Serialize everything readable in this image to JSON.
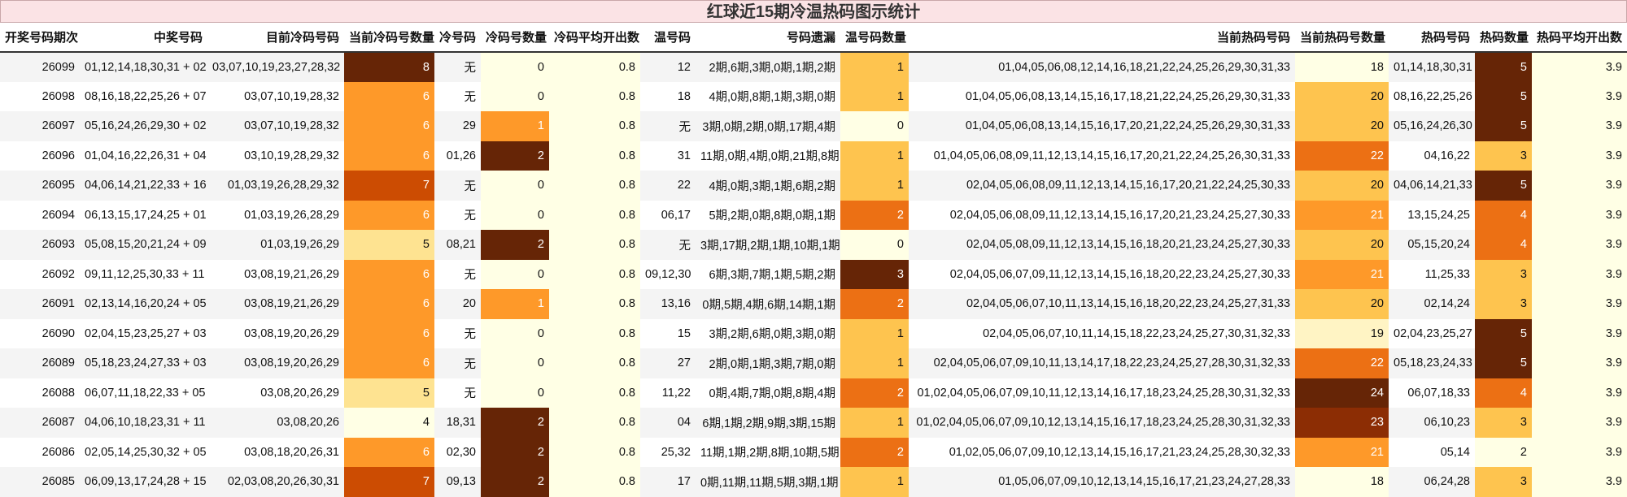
{
  "title": "红球近15期冷温热码图示统计",
  "headers": [
    "开奖号码期次",
    "中奖号码",
    "目前冷码号码",
    "当前冷码号数量",
    "冷号码",
    "冷码号数量",
    "冷码平均开出数",
    "温号码",
    "号码遗漏",
    "温号码数量",
    "当前热码号码",
    "当前热码号数量",
    "热码号码",
    "热码数量",
    "热码平均开出数"
  ],
  "colors": {
    "lv0": "#ffffe5",
    "lv1": "#fff4c4",
    "lv2": "#fee391",
    "lv3": "#fec44f",
    "lv4": "#fe9929",
    "lv5": "#ec7014",
    "lv6": "#cc4c02",
    "lv7": "#8c2d04",
    "lv8": "#662506"
  },
  "rows": [
    [
      "26099",
      "01,12,14,18,30,31 + 02",
      "03,07,10,19,23,27,28,32",
      "8",
      "无",
      "0",
      "0.8",
      "12",
      "2期,6期,3期,0期,1期,2期",
      "1",
      "01,04,05,06,08,12,14,16,18,21,22,24,25,26,29,30,31,33",
      "18",
      "01,14,18,30,31",
      "5",
      "3.9"
    ],
    [
      "26098",
      "08,16,18,22,25,26 + 07",
      "03,07,10,19,28,32",
      "6",
      "无",
      "0",
      "0.8",
      "18",
      "4期,0期,8期,1期,3期,0期",
      "1",
      "01,04,05,06,08,13,14,15,16,17,18,21,22,24,25,26,29,30,31,33",
      "20",
      "08,16,22,25,26",
      "5",
      "3.9"
    ],
    [
      "26097",
      "05,16,24,26,29,30 + 02",
      "03,07,10,19,28,32",
      "6",
      "29",
      "1",
      "0.8",
      "无",
      "3期,0期,2期,0期,17期,4期",
      "0",
      "01,04,05,06,08,13,14,15,16,17,20,21,22,24,25,26,29,30,31,33",
      "20",
      "05,16,24,26,30",
      "5",
      "3.9"
    ],
    [
      "26096",
      "01,04,16,22,26,31 + 04",
      "03,10,19,28,29,32",
      "6",
      "01,26",
      "2",
      "0.8",
      "31",
      "11期,0期,4期,0期,21期,8期",
      "1",
      "01,04,05,06,08,09,11,12,13,14,15,16,17,20,21,22,24,25,26,30,31,33",
      "22",
      "04,16,22",
      "3",
      "3.9"
    ],
    [
      "26095",
      "04,06,14,21,22,33 + 16",
      "01,03,19,26,28,29,32",
      "7",
      "无",
      "0",
      "0.8",
      "22",
      "4期,0期,3期,1期,6期,2期",
      "1",
      "02,04,05,06,08,09,11,12,13,14,15,16,17,20,21,22,24,25,30,33",
      "20",
      "04,06,14,21,33",
      "5",
      "3.9"
    ],
    [
      "26094",
      "06,13,15,17,24,25 + 01",
      "01,03,19,26,28,29",
      "6",
      "无",
      "0",
      "0.8",
      "06,17",
      "5期,2期,0期,8期,0期,1期",
      "2",
      "02,04,05,06,08,09,11,12,13,14,15,16,17,20,21,23,24,25,27,30,33",
      "21",
      "13,15,24,25",
      "4",
      "3.9"
    ],
    [
      "26093",
      "05,08,15,20,21,24 + 09",
      "01,03,19,26,29",
      "5",
      "08,21",
      "2",
      "0.8",
      "无",
      "3期,17期,2期,1期,10期,1期",
      "0",
      "02,04,05,08,09,11,12,13,14,15,16,18,20,21,23,24,25,27,30,33",
      "20",
      "05,15,20,24",
      "4",
      "3.9"
    ],
    [
      "26092",
      "09,11,12,25,30,33 + 11",
      "03,08,19,21,26,29",
      "6",
      "无",
      "0",
      "0.8",
      "09,12,30",
      "6期,3期,7期,1期,5期,2期",
      "3",
      "02,04,05,06,07,09,11,12,13,14,15,16,18,20,22,23,24,25,27,30,33",
      "21",
      "11,25,33",
      "3",
      "3.9"
    ],
    [
      "26091",
      "02,13,14,16,20,24 + 05",
      "03,08,19,21,26,29",
      "6",
      "20",
      "1",
      "0.8",
      "13,16",
      "0期,5期,4期,6期,14期,1期",
      "2",
      "02,04,05,06,07,10,11,13,14,15,16,18,20,22,23,24,25,27,31,33",
      "20",
      "02,14,24",
      "3",
      "3.9"
    ],
    [
      "26090",
      "02,04,15,23,25,27 + 03",
      "03,08,19,20,26,29",
      "6",
      "无",
      "0",
      "0.8",
      "15",
      "3期,2期,6期,0期,3期,0期",
      "1",
      "02,04,05,06,07,10,11,14,15,18,22,23,24,25,27,30,31,32,33",
      "19",
      "02,04,23,25,27",
      "5",
      "3.9"
    ],
    [
      "26089",
      "05,18,23,24,27,33 + 03",
      "03,08,19,20,26,29",
      "6",
      "无",
      "0",
      "0.8",
      "27",
      "2期,0期,1期,3期,7期,0期",
      "1",
      "02,04,05,06,07,09,10,11,13,14,17,18,22,23,24,25,27,28,30,31,32,33",
      "22",
      "05,18,23,24,33",
      "5",
      "3.9"
    ],
    [
      "26088",
      "06,07,11,18,22,33 + 05",
      "03,08,20,26,29",
      "5",
      "无",
      "0",
      "0.8",
      "11,22",
      "0期,4期,7期,0期,8期,4期",
      "2",
      "01,02,04,05,06,07,09,10,11,12,13,14,16,17,18,23,24,25,28,30,31,32,33",
      "24",
      "06,07,18,33",
      "4",
      "3.9"
    ],
    [
      "26087",
      "04,06,10,18,23,31 + 11",
      "03,08,20,26",
      "4",
      "18,31",
      "2",
      "0.8",
      "04",
      "6期,1期,2期,9期,3期,15期",
      "1",
      "01,02,04,05,06,07,09,10,12,13,14,15,16,17,18,23,24,25,28,30,31,32,33",
      "23",
      "06,10,23",
      "3",
      "3.9"
    ],
    [
      "26086",
      "02,05,14,25,30,32 + 05",
      "03,08,18,20,26,31",
      "6",
      "02,30",
      "2",
      "0.8",
      "25,32",
      "11期,1期,2期,8期,10期,5期",
      "2",
      "01,02,05,06,07,09,10,12,13,14,15,16,17,21,23,24,25,28,30,32,33",
      "21",
      "05,14",
      "2",
      "3.9"
    ],
    [
      "26085",
      "06,09,13,17,24,28 + 15",
      "02,03,08,20,26,30,31",
      "7",
      "09,13",
      "2",
      "0.8",
      "17",
      "0期,11期,11期,5期,3期,1期",
      "1",
      "01,05,06,07,09,10,12,13,14,15,16,17,21,23,24,27,28,33",
      "18",
      "06,24,28",
      "3",
      "3.9"
    ]
  ]
}
